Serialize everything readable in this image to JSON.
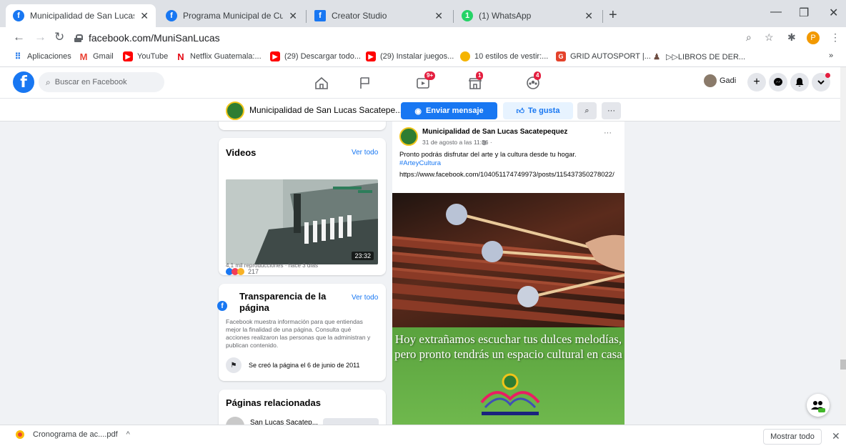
{
  "tabs": [
    {
      "title": "Municipalidad de San Lucas Saca",
      "icon": "facebook-icon",
      "active": true
    },
    {
      "title": "Programa Municipal de Cultura F",
      "icon": "facebook-icon",
      "active": false
    },
    {
      "title": "Creator Studio",
      "icon": "facebook-icon",
      "active": false
    },
    {
      "title": "(1) WhatsApp",
      "icon": "whatsapp-icon",
      "active": false
    }
  ],
  "address": {
    "url": "facebook.com/MuniSanLucas",
    "profile_initial": "P"
  },
  "bookmarks": [
    {
      "label": "Aplicaciones",
      "icon": "apps-grid-icon"
    },
    {
      "label": "Gmail",
      "icon": "gmail-icon"
    },
    {
      "label": "YouTube",
      "icon": "youtube-icon"
    },
    {
      "label": "Netflix Guatemala:...",
      "icon": "netflix-icon"
    },
    {
      "label": "(29) Descargar todo...",
      "icon": "youtube-icon"
    },
    {
      "label": "(29) Instalar juegos...",
      "icon": "youtube-icon"
    },
    {
      "label": "10 estilos de vestir:...",
      "icon": "bookmark-icon"
    },
    {
      "label": "GRID AUTOSPORT |...",
      "icon": "bookmark-icon"
    },
    {
      "label": "▷▷LIBROS DE DER...",
      "icon": "bookmark-icon"
    }
  ],
  "facebook": {
    "search_placeholder": "Buscar en Facebook",
    "badges": {
      "watch": "9+",
      "marketplace": "1",
      "groups": "4"
    },
    "user_name": "Gadi"
  },
  "page_header": {
    "name": "Municipalidad de San Lucas Sacatepe...",
    "message_button": "Enviar mensaje",
    "like_button": "Te gusta",
    "more": "···"
  },
  "videos_card": {
    "title": "Videos",
    "see_all": "Ver todo",
    "duration": "23:32",
    "reactions": "217",
    "meta": "4,1 mil reproducciones · hace 3 días"
  },
  "transparency_card": {
    "title": "Transparencia de la página",
    "see_all": "Ver todo",
    "description": "Facebook muestra información para que entiendas mejor la finalidad de una página. Consulta qué acciones realizaron las personas que la administran y publican contenido.",
    "created": "Se creó la página el 6 de junio de 2011"
  },
  "related_card": {
    "title": "Páginas relacionadas",
    "first_item": "San Lucas Sacatep..."
  },
  "post": {
    "author": "Municipalidad de San Lucas Sacatepequez",
    "time": "31 de agosto a las 11:36 ·",
    "text": "Pronto podrás disfrutar del arte y la cultura desde tu hogar.",
    "hashtag": "#ArteyCultura",
    "link": "https://www.facebook.com/104051174749973/posts/115437350278022/",
    "image_line1": "Hoy extrañamos escuchar tus dulces melodías,",
    "image_line2": "pero pronto tendrás un espacio cultural en casa",
    "more": "···"
  },
  "download": {
    "file": "Cronograma de ac....pdf",
    "show_all": "Mostrar todo"
  }
}
